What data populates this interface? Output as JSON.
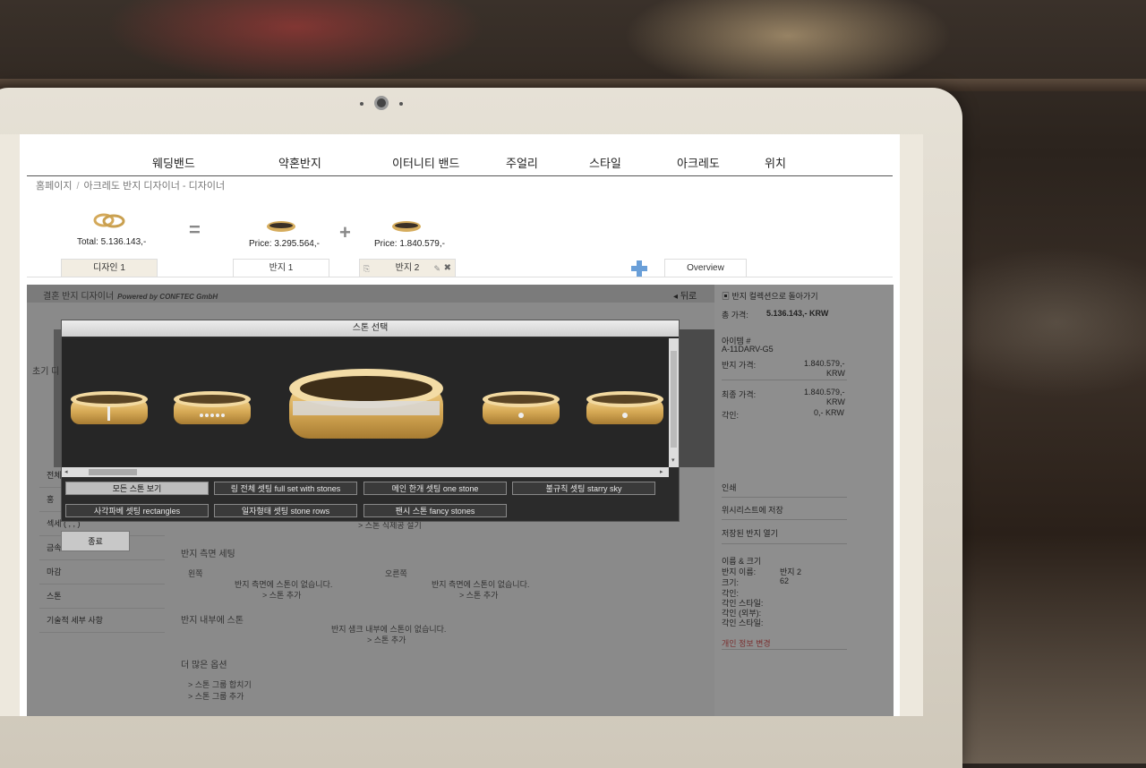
{
  "nav": {
    "items": [
      "웨딩밴드",
      "약혼반지",
      "이터니티 밴드",
      "주얼리",
      "스타일",
      "아크레도",
      "위치"
    ]
  },
  "breadcrumb": {
    "home": "홈페이지",
    "sep": "/",
    "current": "아크레도 반지 디자이너 - 디자이너"
  },
  "summary": {
    "total_label": "Total: 5.136.143,-",
    "equals": "=",
    "plus": "+",
    "ring1_price": "Price: 3.295.564,-",
    "ring2_price": "Price: 1.840.579,-"
  },
  "tabs": {
    "design": "디자인 1",
    "ring1": "반지 1",
    "ring2": "반지 2",
    "overview": "Overview"
  },
  "app": {
    "title": "결혼 반지 디자이너",
    "powered": "Powered by CONFTEC GmbH",
    "back": "뒤로",
    "start_label": "초기 디",
    "left_menu": [
      "전체",
      "홍",
      "섹세 ( , , )",
      "금속",
      "마감",
      "스톤",
      "기술적 세부 사항"
    ],
    "engraving_link": "> 스톤 식제공 설기",
    "side_setting": "반지 측면 세팅",
    "left": "왼쪽",
    "right": "오른쪽",
    "no_stones_side": "반지 측면에 스톤이 없습니다.",
    "add_stone": "> 스톤 추가",
    "inner_stone": "반지 내부에 스톤",
    "no_stones_inner": "반지 샘크 내부에 스톤이 없습니다.",
    "more_options": "더 많은 옵션",
    "group_merge": "> 스톤 그룹 합치기",
    "group_add": "> 스톤 그룹 추가"
  },
  "right_panel": {
    "back_collection": "반지 컬렉션으로 돌아가기",
    "total_label": "총 가격:",
    "total_value": "5.136.143,- KRW",
    "item_label": "아이템 #",
    "item_value": "A-11DARV-G5",
    "ring_price_label": "반지 가격:",
    "ring_price_value": "1.840.579,-",
    "krw": "KRW",
    "final_price_label": "최종 가격:",
    "final_price_value": "1.840.579,-",
    "engraving_label": "각인:",
    "engraving_value": "0,- KRW",
    "print": "인쇄",
    "wishlist": "위시리스트에 저장",
    "open_saved": "저장된 반지 열기",
    "name_size": "이름 & 크기",
    "ring_name_label": "반지 이름:",
    "ring_name_value": "반지 2",
    "size_label": "크기:",
    "size_value": "62",
    "eng1": "각인:",
    "eng2": "각인 스타일:",
    "eng3": "각인 (외부):",
    "eng4": "각인 스타일:",
    "personal_info": "개인 정보 변경"
  },
  "modal": {
    "title": "스톤 선택",
    "buttons": [
      "모든 스톤 보기",
      "링 전체 셋팅 full set with stones",
      "메인 한개 셋팅 one stone",
      "불규칙 셋팅 starry sky",
      "사각파베 셋팅 rectangles",
      "일자형태 셋팅 stone rows",
      "팬시 스톤 fancy stones"
    ],
    "close": "종료"
  },
  "colors": {
    "gold": "#d9b266",
    "accent_blue": "#6a9fd8",
    "dim": "#8a8a8a",
    "modal_bg": "#2b2b2b"
  }
}
